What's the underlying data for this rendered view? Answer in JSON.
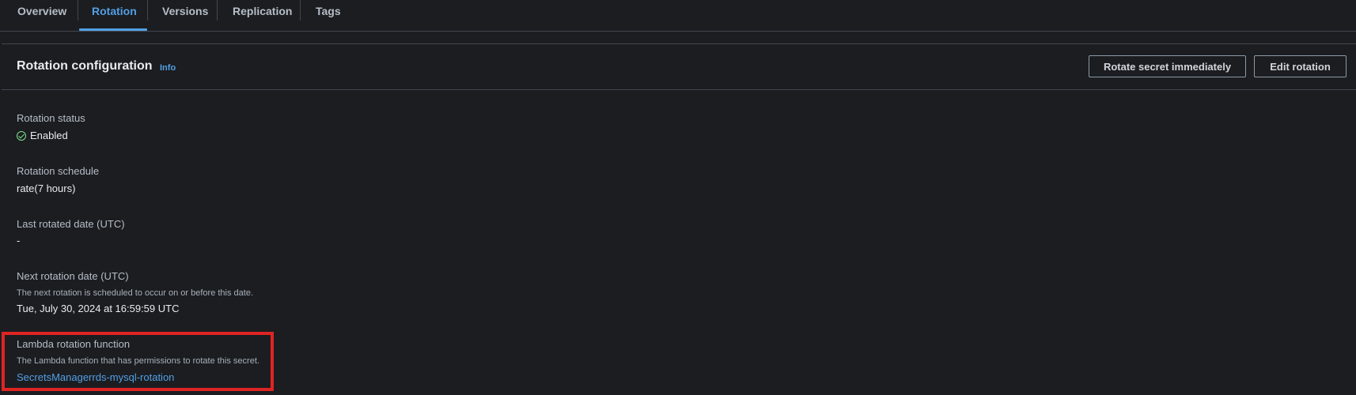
{
  "tabs": [
    {
      "label": "Overview"
    },
    {
      "label": "Rotation"
    },
    {
      "label": "Versions"
    },
    {
      "label": "Replication"
    },
    {
      "label": "Tags"
    }
  ],
  "active_tab": "Rotation",
  "panel": {
    "title": "Rotation configuration",
    "info_label": "Info",
    "rotate_button": "Rotate secret immediately",
    "edit_button": "Edit rotation"
  },
  "fields": {
    "rotation_status": {
      "label": "Rotation status",
      "value": "Enabled"
    },
    "rotation_schedule": {
      "label": "Rotation schedule",
      "value": "rate(7 hours)"
    },
    "last_rotated": {
      "label": "Last rotated date (UTC)",
      "value": "-"
    },
    "next_rotation": {
      "label": "Next rotation date (UTC)",
      "description": "The next rotation is scheduled to occur on or before this date.",
      "value": "Tue, July 30, 2024 at 16:59:59 UTC"
    },
    "lambda_function": {
      "label": "Lambda rotation function",
      "description": "The Lambda function that has permissions to rotate this secret.",
      "value": "SecretsManagerrds-mysql-rotation"
    }
  },
  "colors": {
    "background": "#1b1d20",
    "accent": "#539fe5",
    "success": "#7ee08f",
    "highlight": "#e02424"
  }
}
